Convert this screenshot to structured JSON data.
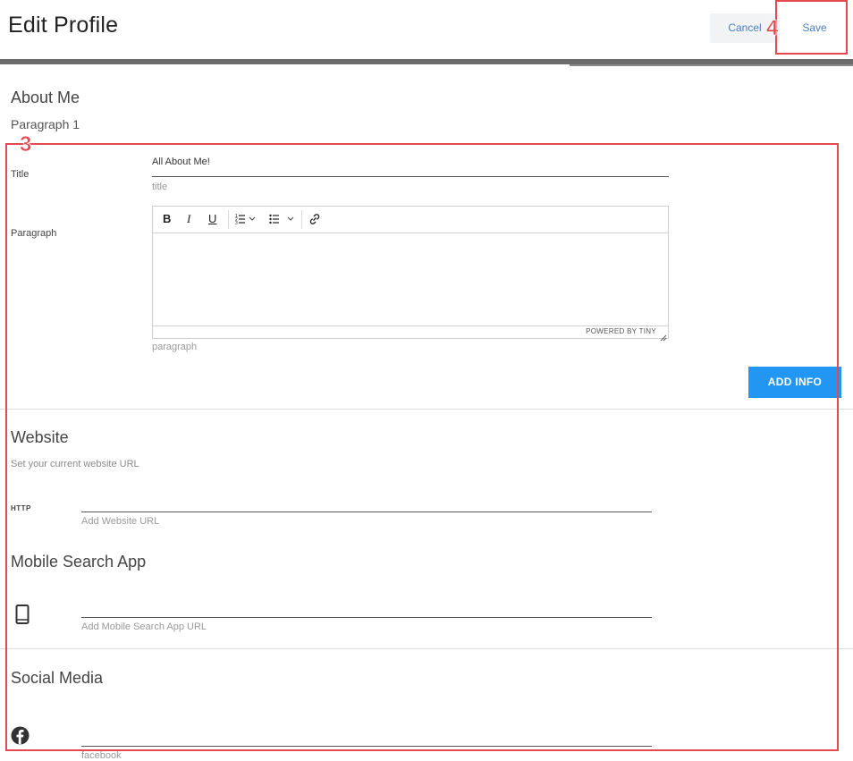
{
  "header": {
    "title": "Edit Profile",
    "cancel_label": "Cancel",
    "save_label": "Save"
  },
  "about": {
    "heading": "About Me",
    "paragraph_heading": "Paragraph 1",
    "title_label": "Title",
    "title_value": "All About Me!",
    "title_hint": "title",
    "paragraph_label": "Paragraph",
    "paragraph_hint": "paragraph",
    "editor": {
      "bold": "B",
      "italic": "I",
      "underline": "U",
      "powered_by": "POWERED BY TINY"
    },
    "add_button": "ADD INFO"
  },
  "website": {
    "heading": "Website",
    "description": "Set your current website URL",
    "prefix": "HTTP",
    "hint": "Add Website URL"
  },
  "mobile": {
    "heading": "Mobile Search App",
    "hint": "Add Mobile Search App URL"
  },
  "social": {
    "heading": "Social Media",
    "facebook_hint": "facebook"
  },
  "annotations": {
    "form_marker": "3",
    "save_marker": "4",
    "color": "#e5484d"
  },
  "colors": {
    "accent": "#2196f3",
    "link": "#4a7fc0"
  },
  "icons": {
    "mobile": "phone-icon",
    "facebook": "facebook-icon"
  }
}
